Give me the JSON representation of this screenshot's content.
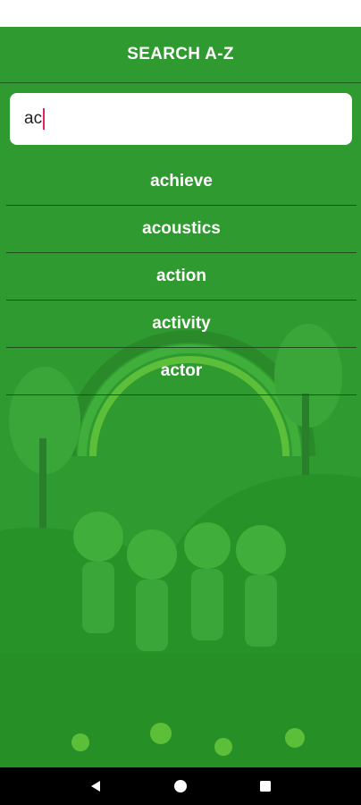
{
  "header": {
    "title": "SEARCH A-Z"
  },
  "search": {
    "value": "ac"
  },
  "results": [
    {
      "label": "achieve"
    },
    {
      "label": "acoustics"
    },
    {
      "label": "action"
    },
    {
      "label": "activity"
    },
    {
      "label": "actor"
    }
  ],
  "theme": {
    "background": "#2f9a2f",
    "text": "#ffffff",
    "caret": "#e0245e"
  },
  "nav": {
    "back_icon": "back-triangle-icon",
    "home_icon": "home-circle-icon",
    "recents_icon": "recents-square-icon"
  }
}
